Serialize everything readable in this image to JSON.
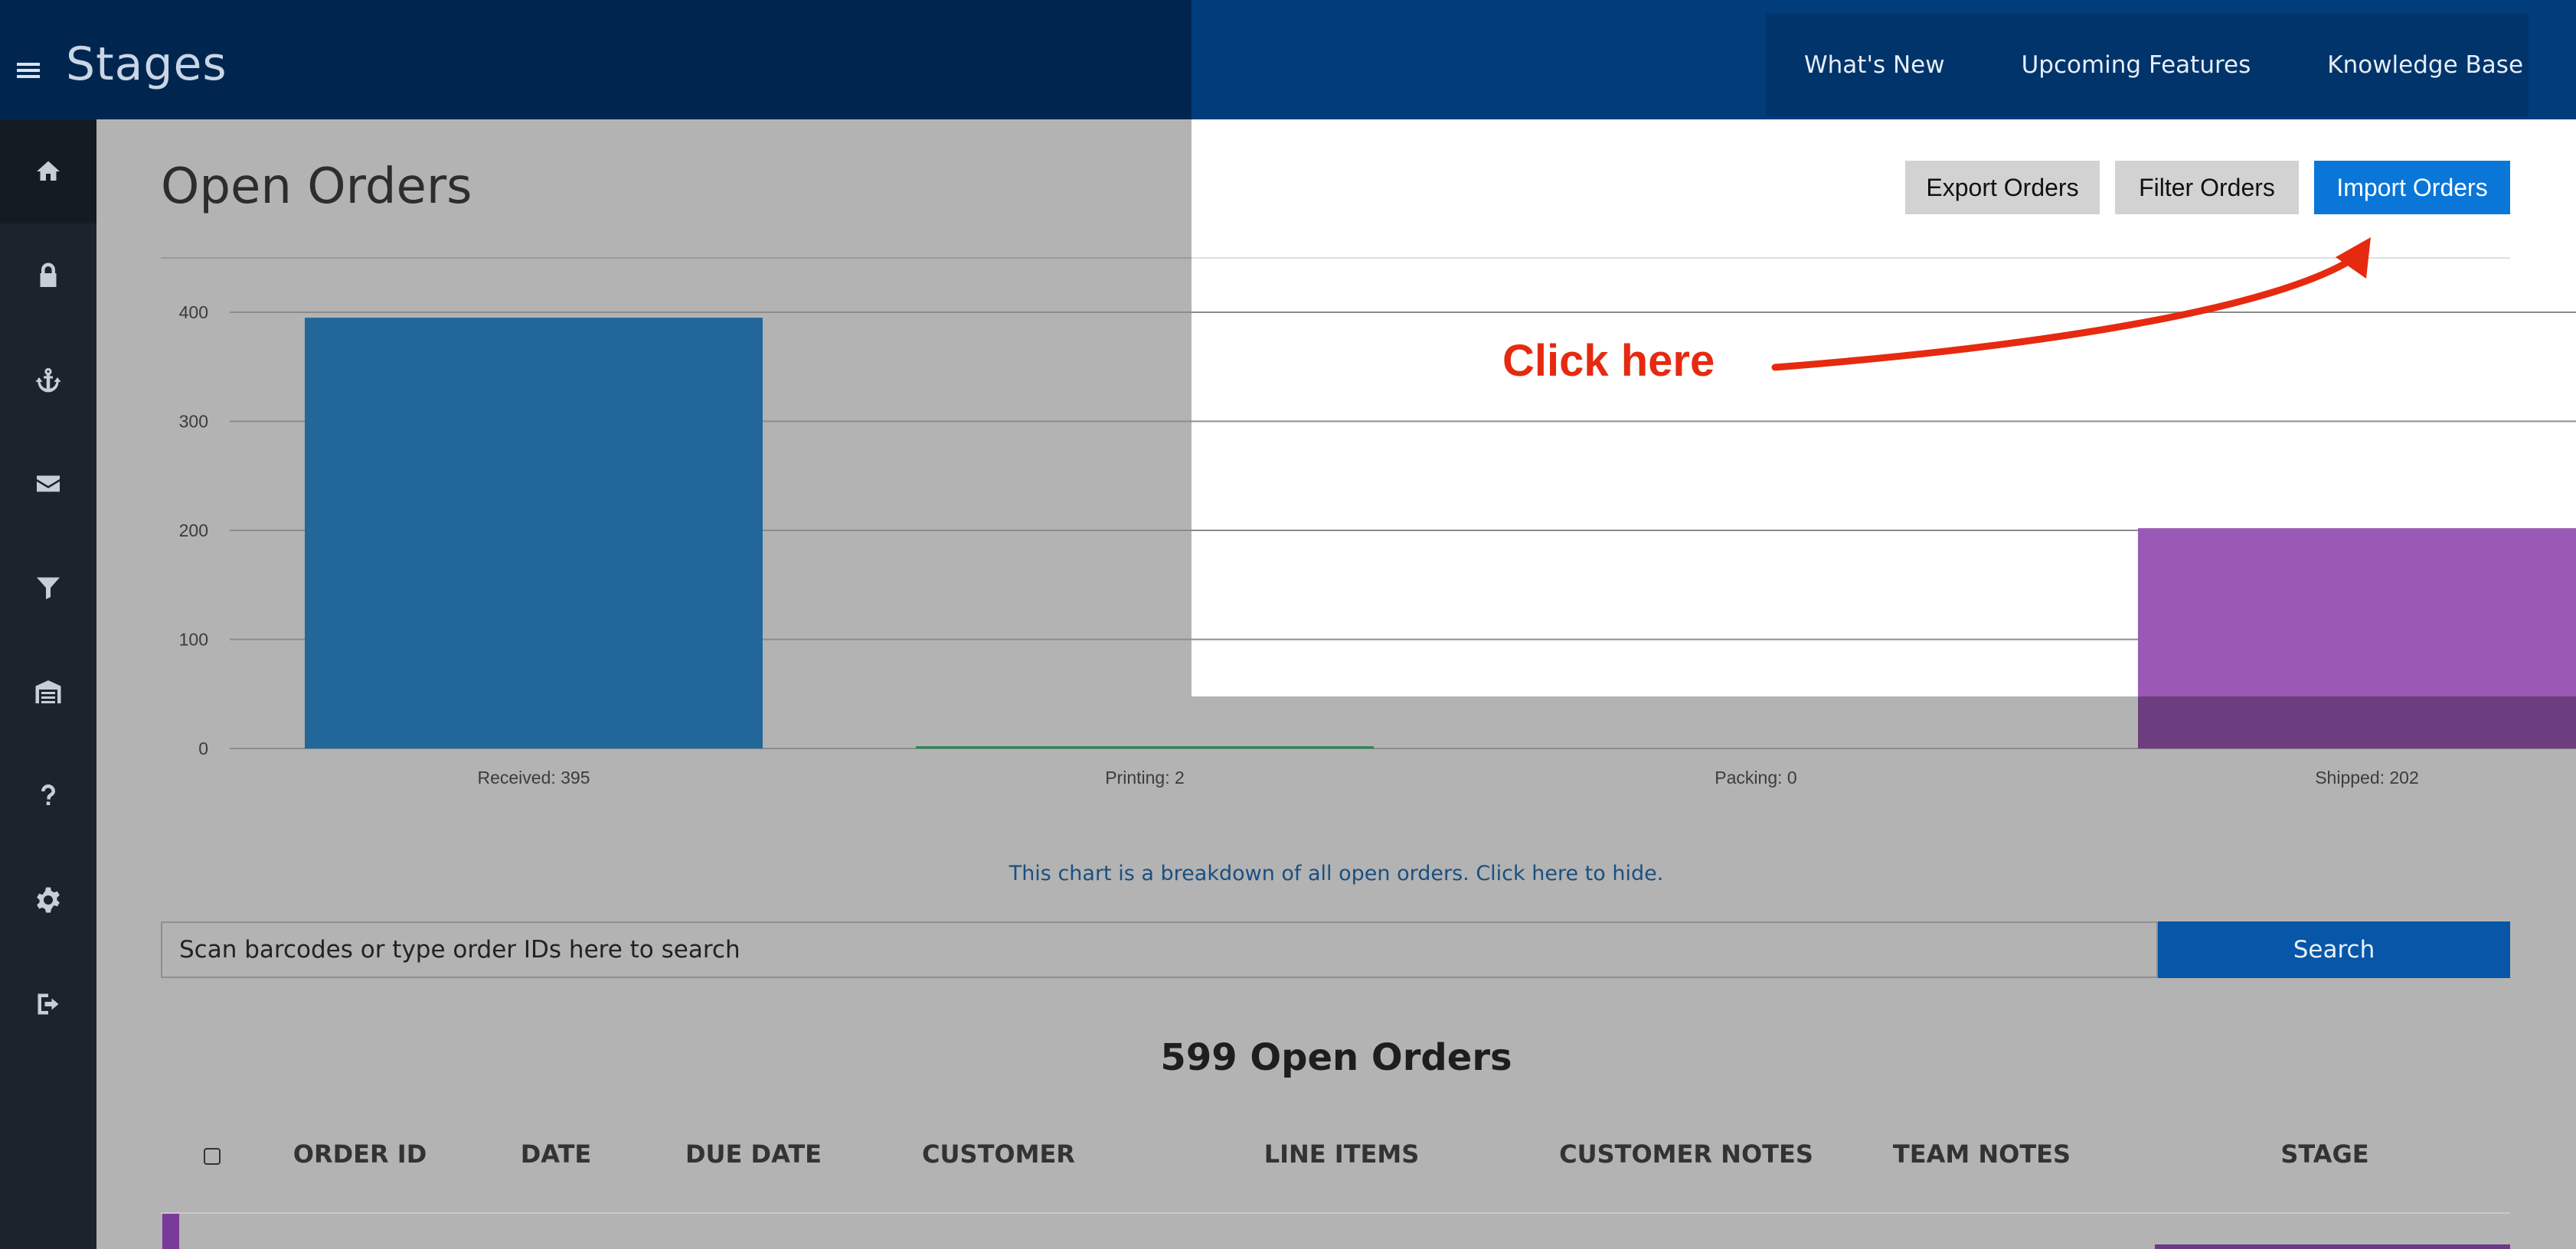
{
  "app": {
    "title": "Stages"
  },
  "topnav": {
    "items": [
      "What's New",
      "Upcoming Features",
      "Knowledge Base"
    ]
  },
  "sidebar": {
    "icons": [
      "home-icon",
      "lock-icon",
      "anchor-icon",
      "envelope-icon",
      "filter-icon",
      "warehouse-icon",
      "question-icon",
      "gear-icon",
      "sign-out-icon"
    ]
  },
  "page": {
    "title": "Open Orders",
    "buttons": {
      "export": "Export Orders",
      "filter": "Filter Orders",
      "import": "Import Orders"
    }
  },
  "annotation": {
    "callout": "Click here",
    "color": "#e62a10"
  },
  "chart_data": {
    "type": "bar",
    "categories": [
      "Received: 395",
      "Printing: 2",
      "Packing: 0",
      "Shipped: 202"
    ],
    "values": [
      395,
      2,
      0,
      202
    ],
    "colors": [
      "#21679a",
      "#1f8a4c",
      "#8a8a8a",
      "#9b59b6"
    ],
    "yticks": [
      0,
      100,
      200,
      300,
      400
    ],
    "ylim": [
      0,
      400
    ],
    "grid": true
  },
  "chart_note": "This chart is a breakdown of all open orders. Click here to hide.",
  "search": {
    "placeholder": "Scan barcodes or type order IDs here to search",
    "button": "Search"
  },
  "orders": {
    "count_label": "599 Open Orders"
  },
  "table": {
    "columns": [
      "ORDER ID",
      "DATE",
      "DUE DATE",
      "CUSTOMER",
      "LINE ITEMS",
      "CUSTOMER NOTES",
      "TEAM NOTES",
      "STAGE"
    ]
  }
}
